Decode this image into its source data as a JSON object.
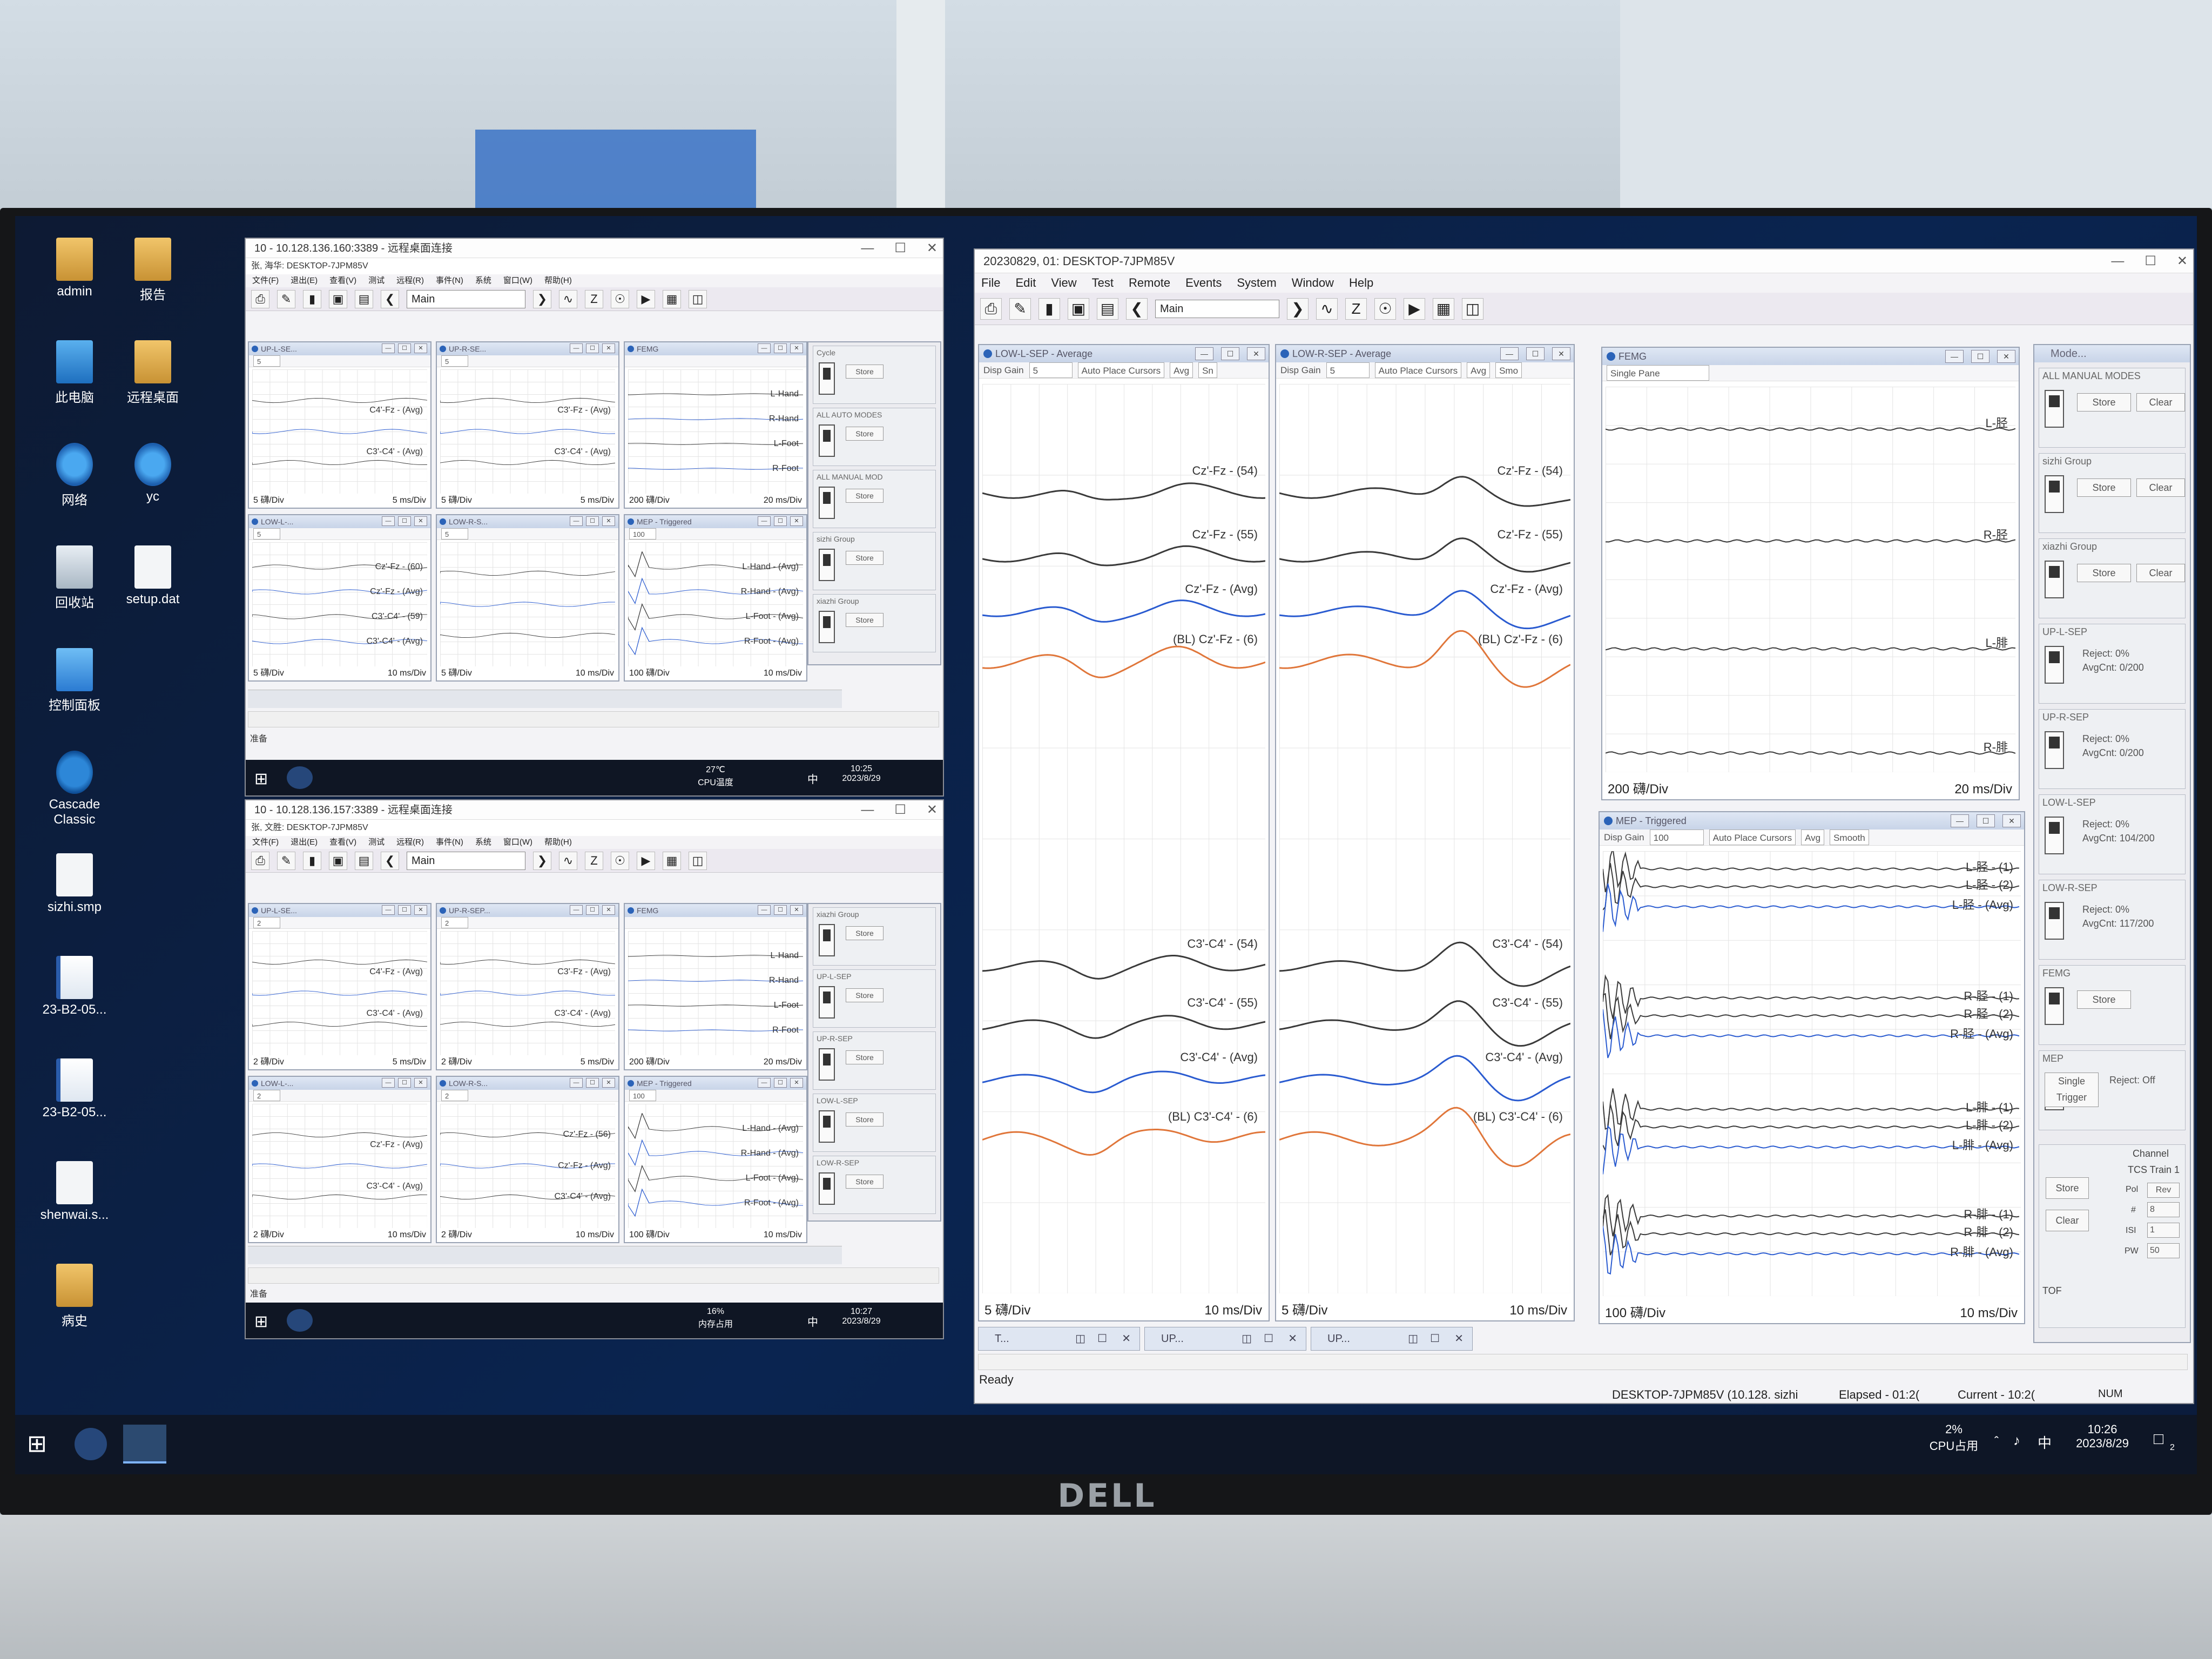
{
  "desktop_icons": [
    {
      "label": "admin",
      "icon": "folder-user-icon",
      "kind": "folder"
    },
    {
      "label": "报告",
      "icon": "folder-icon",
      "kind": "folder"
    },
    {
      "label": "此电脑",
      "icon": "computer-icon",
      "kind": "pc"
    },
    {
      "label": "远程桌面",
      "icon": "folder-icon",
      "kind": "folder"
    },
    {
      "label": "网络",
      "icon": "network-icon",
      "kind": "net"
    },
    {
      "label": "yc",
      "icon": "network-drive-icon",
      "kind": "net"
    },
    {
      "label": "回收站",
      "icon": "recycle-bin-icon",
      "kind": "bin"
    },
    {
      "label": "setup.dat",
      "icon": "file-icon",
      "kind": "file"
    },
    {
      "label": "控制面板",
      "icon": "control-panel-icon",
      "kind": "ctrl"
    },
    {
      "label": "Cascade Classic",
      "icon": "cascade-app-icon",
      "kind": "cascade"
    },
    {
      "label": "sizhi.smp",
      "icon": "file-icon",
      "kind": "file"
    },
    {
      "label": "23-B2-05...",
      "icon": "word-doc-icon",
      "kind": "doc"
    },
    {
      "label": "23-B2-05...",
      "icon": "word-doc-icon",
      "kind": "doc"
    },
    {
      "label": "shenwai.s...",
      "icon": "file-icon",
      "kind": "file"
    },
    {
      "label": "病史",
      "icon": "folder-icon",
      "kind": "folder"
    }
  ],
  "rdp1": {
    "title": "10 - 10.128.136.160:3389 - 远程桌面连接",
    "inner_title": "张, 海华: DESKTOP-7JPM85V",
    "menu": [
      "文件(F)",
      "退出(E)",
      "查看(V)",
      "测试",
      "远程(R)",
      "事件(N)",
      "系统",
      "窗口(W)",
      "帮助(H)"
    ],
    "combo": "Main",
    "panes": [
      {
        "title": "UP-L-SE...",
        "gain": "5",
        "labels": [
          "C4'-Fz - (Avg)",
          "C3'-C4' - (Avg)"
        ],
        "scale_left": "5 礴/Div",
        "scale_right": "5 ms/Div"
      },
      {
        "title": "UP-R-SE...",
        "gain": "5",
        "labels": [
          "C3'-Fz - (Avg)",
          "C3'-C4' - (Avg)"
        ],
        "scale_left": "5 礴/Div",
        "scale_right": "5 ms/Div"
      },
      {
        "title": "FEMG",
        "labels": [
          "L-Hand",
          "R-Hand",
          "L-Foot",
          "R-Foot"
        ],
        "scale_left": "200 礴/Div",
        "scale_right": "20 ms/Div"
      },
      {
        "title": "LOW-L-...",
        "gain": "5",
        "labels": [
          "Cz'-Fz - (60)",
          "Cz'-Fz - (Avg)",
          "C3'-C4' - (59)",
          "C3'-C4' - (Avg)"
        ],
        "scale_left": "5 礴/Div",
        "scale_right": "10 ms/Div"
      },
      {
        "title": "LOW-R-S...",
        "gain": "5",
        "labels": [],
        "scale_left": "5 礴/Div",
        "scale_right": "10 ms/Div"
      },
      {
        "title": "MEP - Triggered",
        "gain": "100",
        "labels": [
          "L-Hand - (Avg)",
          "R-Hand - (Avg)",
          "L-Foot - (Avg)",
          "R-Foot - (Avg)"
        ],
        "scale_left": "100 礴/Div",
        "scale_right": "10 ms/Div"
      }
    ],
    "side_groups": [
      "Cycle",
      "ALL AUTO MODES",
      "ALL MANUAL MOD",
      "sizhi Group",
      "xiazhi Group"
    ],
    "store": "Store",
    "status": "准备",
    "tray": {
      "temp": "27℃",
      "temp_label": "CPU温度",
      "time": "10:25",
      "date": "2023/8/29",
      "ime": "中"
    }
  },
  "rdp2": {
    "title": "10 - 10.128.136.157:3389 - 远程桌面连接",
    "inner_title": "张, 文胜: DESKTOP-7JPM85V",
    "menu": [
      "文件(F)",
      "退出(E)",
      "查看(V)",
      "测试",
      "远程(R)",
      "事件(N)",
      "系统",
      "窗口(W)",
      "帮助(H)"
    ],
    "combo": "Main",
    "panes": [
      {
        "title": "UP-L-SE...",
        "gain": "2",
        "labels": [
          "C4'-Fz - (Avg)",
          "C3'-C4' - (Avg)"
        ],
        "scale_left": "2 礴/Div",
        "scale_right": "5 ms/Div"
      },
      {
        "title": "UP-R-SEP...",
        "gain": "2",
        "labels": [
          "C3'-Fz - (Avg)",
          "C3'-C4' - (Avg)"
        ],
        "scale_left": "2 礴/Div",
        "scale_right": "5 ms/Div"
      },
      {
        "title": "FEMG",
        "labels": [
          "L-Hand",
          "R-Hand",
          "L-Foot",
          "R-Foot"
        ],
        "scale_left": "200 礴/Div",
        "scale_right": "20 ms/Div"
      },
      {
        "title": "LOW-L-...",
        "gain": "2",
        "labels": [
          "Cz'-Fz - (Avg)",
          "C3'-C4' - (Avg)"
        ],
        "scale_left": "2 礴/Div",
        "scale_right": "10 ms/Div"
      },
      {
        "title": "LOW-R-S...",
        "gain": "2",
        "labels": [
          "Cz'-Fz - (56)",
          "Cz'-Fz - (Avg)",
          "C3'-C4' - (Avg)"
        ],
        "scale_left": "2 礴/Div",
        "scale_right": "10 ms/Div"
      },
      {
        "title": "MEP - Triggered",
        "gain": "100",
        "labels": [
          "L-Hand - (Avg)",
          "R-Hand - (Avg)",
          "L-Foot - (Avg)",
          "R-Foot - (Avg)"
        ],
        "scale_left": "100 礴/Div",
        "scale_right": "10 ms/Div"
      }
    ],
    "side_groups": [
      "xiazhi Group",
      "UP-L-SEP",
      "UP-R-SEP",
      "LOW-L-SEP",
      "LOW-R-SEP"
    ],
    "store": "Store",
    "status": "准备",
    "tray": {
      "temp": "16%",
      "temp_label": "内存占用",
      "time": "10:27",
      "date": "2023/8/29",
      "ime": "中"
    }
  },
  "main": {
    "title": "20230829, 01: DESKTOP-7JPM85V",
    "menu": [
      "File",
      "Edit",
      "View",
      "Test",
      "Remote",
      "Events",
      "System",
      "Window",
      "Help"
    ],
    "combo": "Main",
    "low_l": {
      "title": "LOW-L-SEP - Average",
      "gain_label": "Disp Gain",
      "gain": "5",
      "auto": "Auto Place Cursors",
      "avg": "Avg",
      "sm": "Sn",
      "labels": [
        "Cz'-Fz - (54)",
        "Cz'-Fz - (55)",
        "Cz'-Fz - (Avg)",
        "(BL) Cz'-Fz - (6)",
        "C3'-C4' - (54)",
        "C3'-C4' - (55)",
        "C3'-C4' - (Avg)",
        "(BL) C3'-C4' - (6)"
      ],
      "scale_left": "5 礴/Div",
      "scale_right": "10 ms/Div"
    },
    "low_r": {
      "title": "LOW-R-SEP - Average",
      "gain_label": "Disp Gain",
      "gain": "5",
      "auto": "Auto Place Cursors",
      "avg": "Avg",
      "sm": "Smo",
      "labels": [
        "Cz'-Fz - (54)",
        "Cz'-Fz - (55)",
        "Cz'-Fz - (Avg)",
        "(BL) Cz'-Fz - (6)",
        "C3'-C4' - (54)",
        "C3'-C4' - (55)",
        "C3'-C4' - (Avg)",
        "(BL) C3'-C4' - (6)"
      ],
      "scale_left": "5 礴/Div",
      "scale_right": "10 ms/Div"
    },
    "femg": {
      "title": "FEMG",
      "mode": "Single Pane",
      "labels": [
        "L-胫",
        "R-胫",
        "L-腓",
        "R-腓"
      ],
      "scale_left": "200 礴/Div",
      "scale_right": "20 ms/Div"
    },
    "mep": {
      "title": "MEP - Triggered",
      "gain_label": "Disp Gain",
      "gain": "100",
      "auto": "Auto Place Cursors",
      "avg": "Avg",
      "smooth": "Smooth",
      "labels": [
        "L-胫 - (1)",
        "L-胫 - (2)",
        "L-胫 - (Avg)",
        "R-胫 - (1)",
        "R-胫 - (2)",
        "R-胫 - (Avg)",
        "L-腓 - (1)",
        "L-腓 - (2)",
        "L-腓 - (Avg)",
        "R-腓 - (1)",
        "R-腓 - (2)",
        "R-腓 - (Avg)"
      ],
      "scale_left": "100 礴/Div",
      "scale_right": "10 ms/Div"
    },
    "modes": {
      "title": "Mode...",
      "groups": [
        {
          "title": "ALL MANUAL MODES",
          "store": "Store",
          "clear": "Clear"
        },
        {
          "title": "sizhi Group",
          "store": "Store",
          "clear": "Clear"
        },
        {
          "title": "xiazhi Group",
          "store": "Store",
          "clear": "Clear"
        },
        {
          "title": "UP-L-SEP",
          "reject": "Reject:  0%",
          "avgcnt": "AvgCnt:  0/200"
        },
        {
          "title": "UP-R-SEP",
          "reject": "Reject:  0%",
          "avgcnt": "AvgCnt:  0/200"
        },
        {
          "title": "LOW-L-SEP",
          "reject": "Reject:  0%",
          "avgcnt": "AvgCnt:  104/200"
        },
        {
          "title": "LOW-R-SEP",
          "reject": "Reject:  0%",
          "avgcnt": "AvgCnt:  117/200"
        },
        {
          "title": "FEMG",
          "store": "Store"
        },
        {
          "title": "MEP",
          "single": "Single Trigger",
          "reject": "Reject:  Off"
        }
      ],
      "channel": "Channel",
      "train": "TCS Train 1",
      "pol": "Pol",
      "rev": "Rev",
      "hash": "#",
      "hash_val": "8",
      "isi": "ISI",
      "isi_val": "1",
      "pw": "PW",
      "pw_val": "50",
      "store": "Store",
      "clear": "Clear",
      "tof": "TOF"
    },
    "tabs": [
      "T...",
      "UP...",
      "UP..."
    ],
    "status_ready": "Ready",
    "status_host": "DESKTOP-7JPM85V (10.128.  sizhi",
    "status_elapsed": "Elapsed - 01:2(",
    "status_current": "Current - 10:2(",
    "status_num": "NUM"
  },
  "taskbar": {
    "cpu": "2%",
    "cpu_label": "CPU占用",
    "time": "10:26",
    "date": "2023/8/29",
    "ime": "中",
    "notif": "2"
  },
  "monitor_brand": "DELL",
  "colors": {
    "trace_black": "#3a3a3a",
    "trace_blue": "#2a5bd0",
    "trace_orange": "#e0763a"
  }
}
